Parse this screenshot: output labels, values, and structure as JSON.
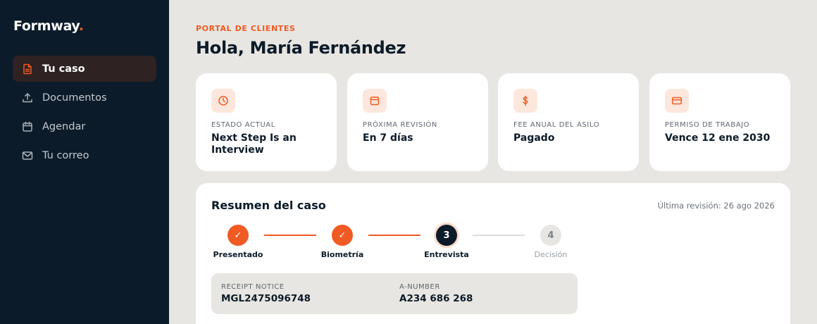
{
  "brand": {
    "name": "Formway",
    "dot": ".",
    "accent_color": "#f15a22",
    "sidebar_color": "#0c1b29"
  },
  "nav": {
    "items": [
      {
        "label": "Tu caso",
        "icon": "document-icon",
        "active": true
      },
      {
        "label": "Documentos",
        "icon": "upload-icon",
        "active": false
      },
      {
        "label": "Agendar",
        "icon": "calendar-icon",
        "active": false
      },
      {
        "label": "Tu correo",
        "icon": "mail-icon",
        "active": false
      }
    ]
  },
  "header": {
    "eyebrow": "PORTAL DE CLIENTES",
    "greeting": "Hola, María Fernández"
  },
  "stats": [
    {
      "label": "ESTADO ACTUAL",
      "value": "Next Step Is an Interview",
      "icon": "clock-icon"
    },
    {
      "label": "PRÓXIMA REVISIÓN",
      "value": "En 7 días",
      "icon": "calendar-icon"
    },
    {
      "label": "FEE ANUAL DEL ASILO",
      "value": "Pagado",
      "icon": "dollar-icon"
    },
    {
      "label": "PERMISO DE TRABAJO",
      "value": "Vence 12 ene 2030",
      "icon": "card-icon"
    }
  ],
  "summary": {
    "title": "Resumen del caso",
    "last_review": "Última revisión: 26 ago 2026",
    "steps": [
      {
        "label": "Presentado",
        "marker": "✓",
        "status": "done"
      },
      {
        "label": "Biometría",
        "marker": "✓",
        "status": "done"
      },
      {
        "label": "Entrevista",
        "marker": "3",
        "status": "current"
      },
      {
        "label": "Decisión",
        "marker": "4",
        "status": "pending"
      }
    ],
    "receipt_label": "RECEIPT NOTICE",
    "receipt_value": "MGL2475096748",
    "anumber_label": "A-NUMBER",
    "anumber_value": "A234 686 268"
  }
}
